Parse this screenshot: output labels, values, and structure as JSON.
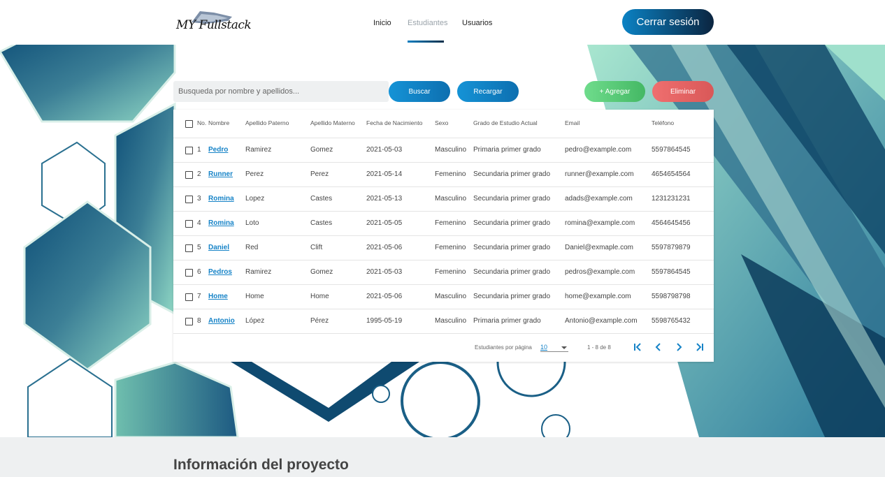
{
  "header": {
    "logo_text": "MY Fullstack",
    "nav": [
      {
        "label": "Inicio"
      },
      {
        "label": "Estudiantes"
      },
      {
        "label": "Usuarios"
      }
    ],
    "logout_label": "Cerrar sesión"
  },
  "toolbar": {
    "search_placeholder": "Busqueda por nombre y apellidos...",
    "search_label": "Buscar",
    "reload_label": "Recargar",
    "add_label": "+ Agregar",
    "delete_label": "Eliminar"
  },
  "table": {
    "headers": [
      "No.",
      "Nombre",
      "Apellido Paterno",
      "Apellido Materno",
      "Fecha de Nacimiento",
      "Sexo",
      "Grado de Estudio Actual",
      "Email",
      "Teléfono"
    ],
    "rows": [
      {
        "no": "1",
        "nombre": "Pedro",
        "paterno": "Ramirez",
        "materno": "Gomez",
        "fecha": "2021-05-03",
        "sexo": "Masculino",
        "grado": "Primaria primer grado",
        "email": "pedro@example.com",
        "telefono": "5597864545"
      },
      {
        "no": "2",
        "nombre": "Runner",
        "paterno": "Perez",
        "materno": "Perez",
        "fecha": "2021-05-14",
        "sexo": "Femenino",
        "grado": "Secundaria primer grado",
        "email": "runner@example.com",
        "telefono": "4654654564"
      },
      {
        "no": "3",
        "nombre": "Romina",
        "paterno": "Lopez",
        "materno": "Castes",
        "fecha": "2021-05-13",
        "sexo": "Masculino",
        "grado": "Secundaria primer grado",
        "email": "adads@example.com",
        "telefono": "1231231231"
      },
      {
        "no": "4",
        "nombre": "Romina",
        "paterno": "Loto",
        "materno": "Castes",
        "fecha": "2021-05-05",
        "sexo": "Femenino",
        "grado": "Secundaria primer grado",
        "email": "romina@example.com",
        "telefono": "4564645456"
      },
      {
        "no": "5",
        "nombre": "Daniel",
        "paterno": "Red",
        "materno": "Clift",
        "fecha": "2021-05-06",
        "sexo": "Femenino",
        "grado": "Secundaria primer grado",
        "email": "Daniel@exmaple.com",
        "telefono": "5597879879"
      },
      {
        "no": "6",
        "nombre": "Pedros",
        "paterno": "Ramirez",
        "materno": "Gomez",
        "fecha": "2021-05-03",
        "sexo": "Femenino",
        "grado": "Secundaria primer grado",
        "email": "pedros@example.com",
        "telefono": "5597864545"
      },
      {
        "no": "7",
        "nombre": "Home",
        "paterno": "Home",
        "materno": "Home",
        "fecha": "2021-05-06",
        "sexo": "Masculino",
        "grado": "Secundaria primer grado",
        "email": "home@example.com",
        "telefono": "5598798798"
      },
      {
        "no": "8",
        "nombre": "Antonio",
        "paterno": "López",
        "materno": "Pérez",
        "fecha": "1995-05-19",
        "sexo": "Masculino",
        "grado": "Primaria primer grado",
        "email": "Antonio@example.com",
        "telefono": "5598765432"
      }
    ]
  },
  "pager": {
    "per_page_label": "Estudiantes por página",
    "per_page_value": "10",
    "range_label": "1 - 8 de 8"
  },
  "footer": {
    "title": "Información del proyecto"
  },
  "icons": [
    "first-page-icon",
    "chevron-left-icon",
    "chevron-right-icon",
    "last-page-icon",
    "dropdown-arrow-icon",
    "checkbox-icon"
  ],
  "colors": {
    "primary": "#1683c7",
    "dark": "#0b2540",
    "add": "#5cc97a",
    "delete": "#e46464"
  }
}
